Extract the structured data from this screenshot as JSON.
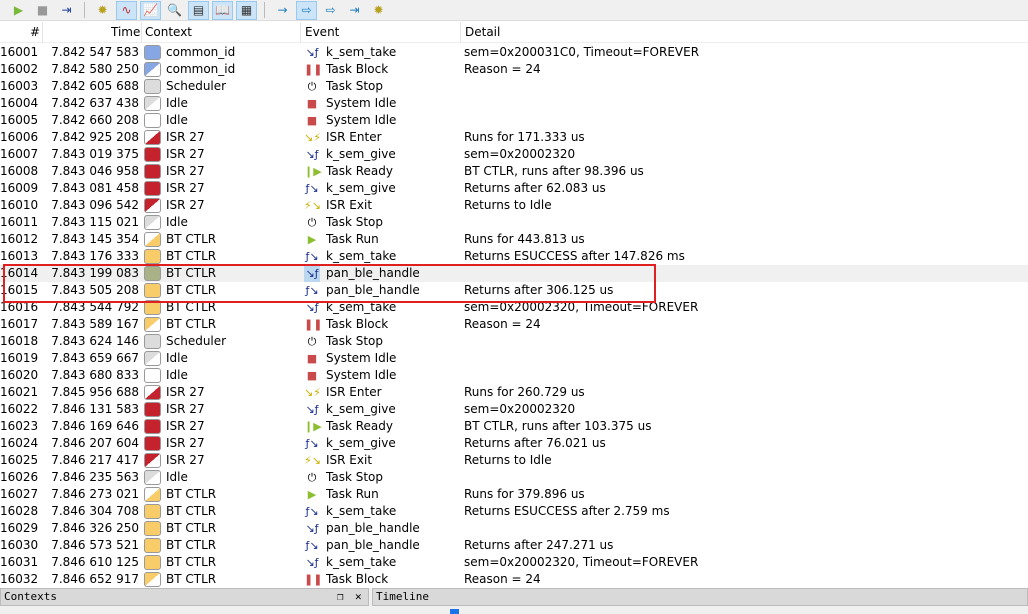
{
  "toolbar": {
    "buttons": [
      "play-icon",
      "stop-icon",
      "step-icon",
      "gear-icon",
      "wave-icon",
      "chart-icon",
      "zoom-icon",
      "log-icon",
      "book-icon",
      "table-icon",
      "arrow-right-icon",
      "arrow-box-icon",
      "arrow-box2-icon",
      "arrow-end-icon",
      "gear-box-icon"
    ]
  },
  "header": {
    "num": "#",
    "time": "Time",
    "context": "Context",
    "event": "Event",
    "detail": "Detail"
  },
  "colors": {
    "blue": "#86a6e4",
    "grey": "#dcdcdc",
    "red": "#c4222c",
    "yellow": "#f9cc6a",
    "olive": "#a9b287",
    "highlight": "#e02020"
  },
  "rows": [
    [
      "16001",
      "7.842 547 583",
      "common_id",
      "blue",
      "full",
      "k_sem_take",
      "fx-in",
      "sem=0x200031C0, Timeout=FOREVER"
    ],
    [
      "16002",
      "7.842 580 250",
      "common_id",
      "blue",
      "tl",
      "Task Block",
      "pause",
      "Reason = 24"
    ],
    [
      "16003",
      "7.842 605 688",
      "Scheduler",
      "grey",
      "full",
      "Task Stop",
      "power",
      ""
    ],
    [
      "16004",
      "7.842 637 438",
      "Idle",
      "grey",
      "tl",
      "System Idle",
      "square",
      ""
    ],
    [
      "16005",
      "7.842 660 208",
      "Idle",
      "white",
      "full",
      "System Idle",
      "square",
      ""
    ],
    [
      "16006",
      "7.842 925 208",
      "ISR 27",
      "red",
      "br",
      "ISR Enter",
      "bolt-in",
      "Runs for 171.333 us"
    ],
    [
      "16007",
      "7.843 019 375",
      "ISR 27",
      "red",
      "full",
      "k_sem_give",
      "fx-in",
      "sem=0x20002320"
    ],
    [
      "16008",
      "7.843 046 958",
      "ISR 27",
      "red",
      "full",
      "Task Ready",
      "ready",
      "BT CTLR, runs after 98.396 us"
    ],
    [
      "16009",
      "7.843 081 458",
      "ISR 27",
      "red",
      "full",
      "k_sem_give",
      "fx-out",
      "Returns after 62.083 us"
    ],
    [
      "16010",
      "7.843 096 542",
      "ISR 27",
      "red",
      "tl",
      "ISR Exit",
      "bolt-out",
      "Returns to Idle"
    ],
    [
      "16011",
      "7.843 115 021",
      "Idle",
      "grey",
      "tl",
      "Task Stop",
      "power",
      ""
    ],
    [
      "16012",
      "7.843 145 354",
      "BT CTLR",
      "yellow",
      "br",
      "Task Run",
      "play",
      "Runs for 443.813 us"
    ],
    [
      "16013",
      "7.843 176 333",
      "BT CTLR",
      "yellow",
      "full",
      "k_sem_take",
      "fx-out",
      "Returns ESUCCESS after 147.826 ms"
    ],
    [
      "16014",
      "7.843 199 083",
      "BT CTLR",
      "olive",
      "full",
      "pan_ble_handle",
      "fx-in",
      "",
      true
    ],
    [
      "16015",
      "7.843 505 208",
      "BT CTLR",
      "yellow",
      "full",
      "pan_ble_handle",
      "fx-out",
      "Returns after 306.125 us"
    ],
    [
      "16016",
      "7.843 544 792",
      "BT CTLR",
      "yellow",
      "full",
      "k_sem_take",
      "fx-in",
      "sem=0x20002320, Timeout=FOREVER"
    ],
    [
      "16017",
      "7.843 589 167",
      "BT CTLR",
      "yellow",
      "tl",
      "Task Block",
      "pause",
      "Reason = 24"
    ],
    [
      "16018",
      "7.843 624 146",
      "Scheduler",
      "grey",
      "full",
      "Task Stop",
      "power",
      ""
    ],
    [
      "16019",
      "7.843 659 667",
      "Idle",
      "grey",
      "tl",
      "System Idle",
      "square",
      ""
    ],
    [
      "16020",
      "7.843 680 833",
      "Idle",
      "white",
      "full",
      "System Idle",
      "square",
      ""
    ],
    [
      "16021",
      "7.845 956 688",
      "ISR 27",
      "red",
      "br",
      "ISR Enter",
      "bolt-in",
      "Runs for 260.729 us"
    ],
    [
      "16022",
      "7.846 131 583",
      "ISR 27",
      "red",
      "full",
      "k_sem_give",
      "fx-in",
      "sem=0x20002320"
    ],
    [
      "16023",
      "7.846 169 646",
      "ISR 27",
      "red",
      "full",
      "Task Ready",
      "ready",
      "BT CTLR, runs after 103.375 us"
    ],
    [
      "16024",
      "7.846 207 604",
      "ISR 27",
      "red",
      "full",
      "k_sem_give",
      "fx-out",
      "Returns after 76.021 us"
    ],
    [
      "16025",
      "7.846 217 417",
      "ISR 27",
      "red",
      "tl",
      "ISR Exit",
      "bolt-out",
      "Returns to Idle"
    ],
    [
      "16026",
      "7.846 235 563",
      "Idle",
      "grey",
      "tl",
      "Task Stop",
      "power",
      ""
    ],
    [
      "16027",
      "7.846 273 021",
      "BT CTLR",
      "yellow",
      "br",
      "Task Run",
      "play",
      "Runs for 379.896 us"
    ],
    [
      "16028",
      "7.846 304 708",
      "BT CTLR",
      "yellow",
      "full",
      "k_sem_take",
      "fx-out",
      "Returns ESUCCESS after 2.759 ms"
    ],
    [
      "16029",
      "7.846 326 250",
      "BT CTLR",
      "yellow",
      "full",
      "pan_ble_handle",
      "fx-in",
      ""
    ],
    [
      "16030",
      "7.846 573 521",
      "BT CTLR",
      "yellow",
      "full",
      "pan_ble_handle",
      "fx-out",
      "Returns after 247.271 us"
    ],
    [
      "16031",
      "7.846 610 125",
      "BT CTLR",
      "yellow",
      "full",
      "k_sem_take",
      "fx-in",
      "sem=0x20002320, Timeout=FOREVER"
    ],
    [
      "16032",
      "7.846 652 917",
      "BT CTLR",
      "yellow",
      "tl",
      "Task Block",
      "pause",
      "Reason = 24"
    ]
  ],
  "panels": {
    "contexts": "Contexts",
    "timeline": "Timeline"
  }
}
